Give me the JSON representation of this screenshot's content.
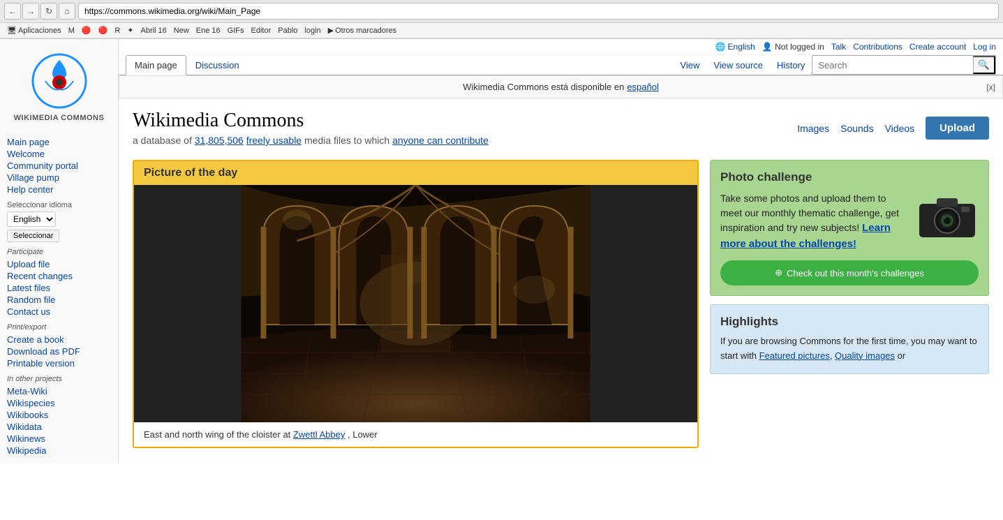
{
  "browser": {
    "url": "https://commons.wikimedia.org/wiki/Main_Page",
    "back_btn": "←",
    "forward_btn": "→",
    "reload_btn": "↻",
    "home_btn": "⌂",
    "bookmarks_label": "Aplicaciones",
    "bookmark_items": [
      {
        "label": "Aplicaciones",
        "icon": "🖥"
      },
      {
        "label": "Abril 16"
      },
      {
        "label": "New"
      },
      {
        "label": "Ene 16"
      },
      {
        "label": "GIFs"
      },
      {
        "label": "Editor"
      },
      {
        "label": "Pablo"
      },
      {
        "label": "login"
      },
      {
        "label": "Otros marcadores"
      }
    ]
  },
  "topbar": {
    "language_icon": "🌐",
    "language": "English",
    "not_logged_in": "Not logged in",
    "talk": "Talk",
    "contributions": "Contributions",
    "create_account": "Create account",
    "log_in": "Log in"
  },
  "tabs": {
    "main_page": "Main page",
    "discussion": "Discussion",
    "view": "View",
    "view_source": "View source",
    "history": "History",
    "search_placeholder": "Search"
  },
  "notice": {
    "text": "Wikimedia Commons está disponible en",
    "link_text": "español",
    "close": "[x]"
  },
  "wiki": {
    "title": "Wikimedia Commons",
    "subtitle_prefix": "a database of",
    "count": "31,805,506",
    "subtitle_mid": "freely usable",
    "subtitle_suffix": "media files to which",
    "contribute_text": "anyone can contribute"
  },
  "media_buttons": {
    "images": "Images",
    "sounds": "Sounds",
    "videos": "Videos",
    "upload": "Upload"
  },
  "potd": {
    "header": "Picture of the day",
    "caption_prefix": "East and north wing of the cloister at",
    "caption_link": "Zwettl Abbey",
    "caption_suffix": ", Lower"
  },
  "photo_challenge": {
    "header": "Photo challenge",
    "text": "Take some photos and upload them to meet our monthly thematic challenge, get inspiration and try new subjects!",
    "link_text": "Learn more about the challenges!",
    "btn_text": "Check out this month's challenges"
  },
  "highlights": {
    "header": "Highlights",
    "text": "If you are browsing Commons for the first time, you may want to start with",
    "link1": "Featured pictures",
    "link2": "Quality images"
  },
  "sidebar": {
    "logo_text": "WIKIMEDIA\nCOMMONS",
    "nav": {
      "main_page": "Main page",
      "welcome": "Welcome",
      "community_portal": "Community portal",
      "village_pump": "Village pump",
      "help_center": "Help center"
    },
    "lang_section": "Seleccionar idioma",
    "lang_selected": "English",
    "seleccionar_btn": "Seleccionar",
    "participate_label": "Participate",
    "participate": {
      "upload_file": "Upload file",
      "recent_changes": "Recent changes",
      "latest_files": "Latest files",
      "random_file": "Random file",
      "contact_us": "Contact us"
    },
    "print_export_label": "Print/export",
    "print_export": {
      "create_book": "Create a book",
      "download_pdf": "Download as PDF",
      "printable_version": "Printable version"
    },
    "other_projects_label": "In other projects",
    "other_projects": {
      "meta_wiki": "Meta-Wiki",
      "wikispecies": "Wikispecies",
      "wikibooks": "Wikibooks",
      "wikidata": "Wikidata",
      "wikinews": "Wikinews",
      "wikipedia": "Wikipedia"
    }
  },
  "colors": {
    "link": "#0645ad",
    "potd_border": "#f5a800",
    "potd_header_bg": "#f5c842",
    "challenge_bg": "#a8d58f",
    "challenge_btn": "#3cb043",
    "upload_btn": "#3476b0",
    "highlights_bg": "#d6e8f5"
  }
}
